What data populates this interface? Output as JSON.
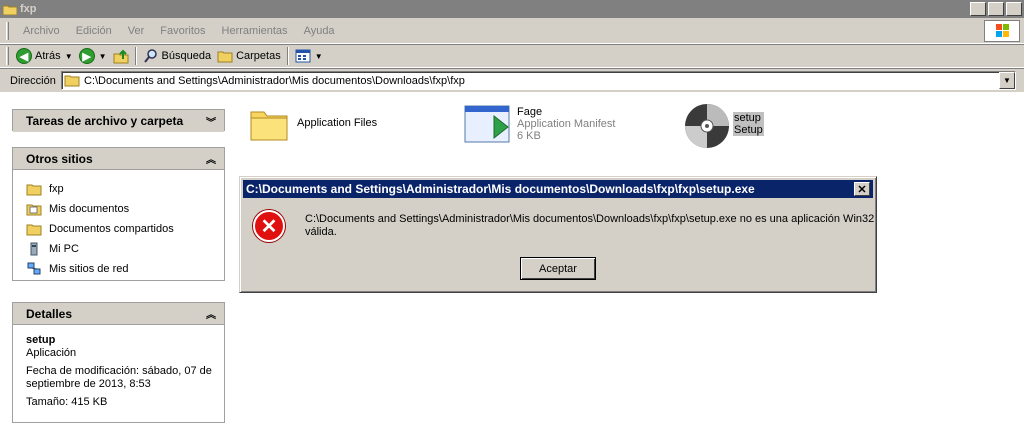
{
  "window": {
    "title": "fxp"
  },
  "menu": [
    "Archivo",
    "Edición",
    "Ver",
    "Favoritos",
    "Herramientas",
    "Ayuda"
  ],
  "toolbar": {
    "back": "Atrás",
    "search": "Búsqueda",
    "folders": "Carpetas"
  },
  "address": {
    "label": "Dirección",
    "path": "C:\\Documents and Settings\\Administrador\\Mis documentos\\Downloads\\fxp\\fxp"
  },
  "tasks": {
    "title": "Tareas de archivo y carpeta"
  },
  "other": {
    "title": "Otros sitios",
    "items": [
      "fxp",
      "Mis documentos",
      "Documentos compartidos",
      "Mi PC",
      "Mis sitios de red"
    ]
  },
  "details": {
    "title": "Detalles",
    "name": "setup",
    "type": "Aplicación",
    "modified": "Fecha de modificación: sábado, 07 de septiembre de 2013, 8:53",
    "size": "Tamaño: 415 KB"
  },
  "files": [
    {
      "name": "Application Files"
    },
    {
      "name": "Fage",
      "type": "Application Manifest",
      "size": "6 KB"
    },
    {
      "name": "setup",
      "type": "Setup"
    }
  ],
  "dialog": {
    "title": "C:\\Documents and Settings\\Administrador\\Mis documentos\\Downloads\\fxp\\fxp\\setup.exe",
    "message": "C:\\Documents and Settings\\Administrador\\Mis documentos\\Downloads\\fxp\\fxp\\setup.exe no es una aplicación Win32 válida.",
    "button": "Aceptar"
  },
  "colors": {
    "dialog_title": "#0a246a",
    "face": "#d4d0c8",
    "error": "#e01010"
  }
}
